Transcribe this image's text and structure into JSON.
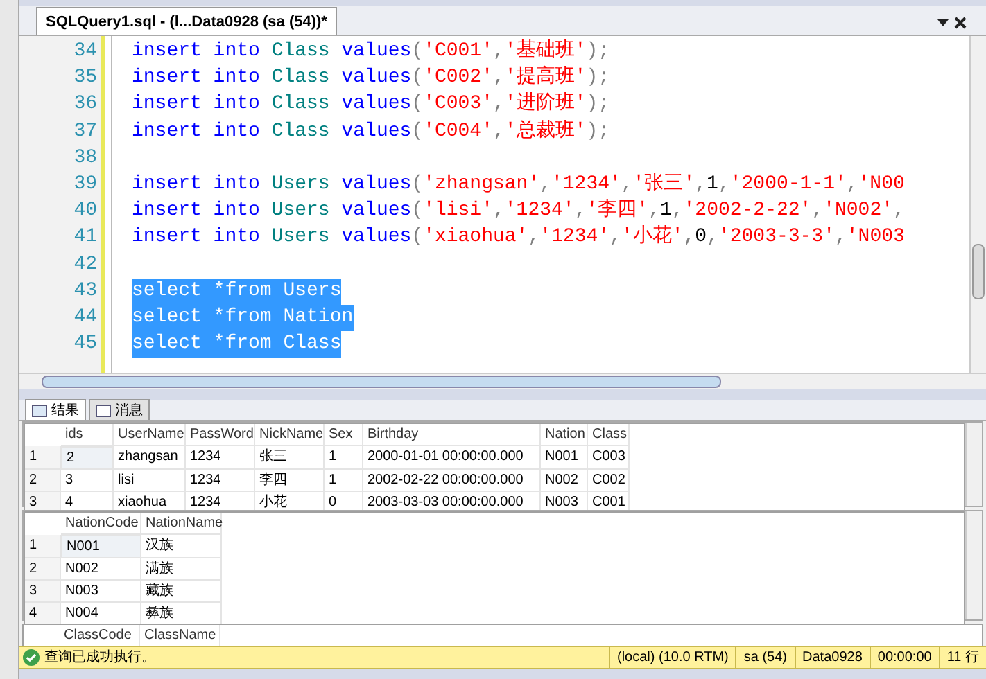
{
  "document_tab": {
    "title": "SQLQuery1.sql - (l...Data0928 (sa (54))*",
    "selected": true
  },
  "editor": {
    "lines": [
      {
        "number": "34",
        "selected": false,
        "tokens": [
          {
            "kind": "keyword",
            "text": "insert into "
          },
          {
            "kind": "object",
            "text": "Class "
          },
          {
            "kind": "keyword",
            "text": "values"
          },
          {
            "kind": "punct",
            "text": "("
          },
          {
            "kind": "string",
            "text": "'C001'"
          },
          {
            "kind": "punct",
            "text": ","
          },
          {
            "kind": "string",
            "text": "'基础班'"
          },
          {
            "kind": "punct",
            "text": ");"
          }
        ]
      },
      {
        "number": "35",
        "selected": false,
        "tokens": [
          {
            "kind": "keyword",
            "text": "insert into "
          },
          {
            "kind": "object",
            "text": "Class "
          },
          {
            "kind": "keyword",
            "text": "values"
          },
          {
            "kind": "punct",
            "text": "("
          },
          {
            "kind": "string",
            "text": "'C002'"
          },
          {
            "kind": "punct",
            "text": ","
          },
          {
            "kind": "string",
            "text": "'提高班'"
          },
          {
            "kind": "punct",
            "text": ");"
          }
        ]
      },
      {
        "number": "36",
        "selected": false,
        "tokens": [
          {
            "kind": "keyword",
            "text": "insert into "
          },
          {
            "kind": "object",
            "text": "Class "
          },
          {
            "kind": "keyword",
            "text": "values"
          },
          {
            "kind": "punct",
            "text": "("
          },
          {
            "kind": "string",
            "text": "'C003'"
          },
          {
            "kind": "punct",
            "text": ","
          },
          {
            "kind": "string",
            "text": "'进阶班'"
          },
          {
            "kind": "punct",
            "text": ");"
          }
        ]
      },
      {
        "number": "37",
        "selected": false,
        "tokens": [
          {
            "kind": "keyword",
            "text": "insert into "
          },
          {
            "kind": "object",
            "text": "Class "
          },
          {
            "kind": "keyword",
            "text": "values"
          },
          {
            "kind": "punct",
            "text": "("
          },
          {
            "kind": "string",
            "text": "'C004'"
          },
          {
            "kind": "punct",
            "text": ","
          },
          {
            "kind": "string",
            "text": "'总裁班'"
          },
          {
            "kind": "punct",
            "text": ");"
          }
        ]
      },
      {
        "number": "38",
        "selected": false
      },
      {
        "number": "39",
        "selected": false,
        "tokens": [
          {
            "kind": "keyword",
            "text": "insert into "
          },
          {
            "kind": "object",
            "text": "Users "
          },
          {
            "kind": "keyword",
            "text": "values"
          },
          {
            "kind": "punct",
            "text": "("
          },
          {
            "kind": "string",
            "text": "'zhangsan'"
          },
          {
            "kind": "punct",
            "text": ","
          },
          {
            "kind": "string",
            "text": "'1234'"
          },
          {
            "kind": "punct",
            "text": ","
          },
          {
            "kind": "string",
            "text": "'张三'"
          },
          {
            "kind": "punct",
            "text": ","
          },
          {
            "kind": "number",
            "text": "1"
          },
          {
            "kind": "punct",
            "text": ","
          },
          {
            "kind": "string",
            "text": "'2000-1-1'"
          },
          {
            "kind": "punct",
            "text": ","
          },
          {
            "kind": "string",
            "text": "'N00"
          }
        ]
      },
      {
        "number": "40",
        "selected": false,
        "tokens": [
          {
            "kind": "keyword",
            "text": "insert into "
          },
          {
            "kind": "object",
            "text": "Users "
          },
          {
            "kind": "keyword",
            "text": "values"
          },
          {
            "kind": "punct",
            "text": "("
          },
          {
            "kind": "string",
            "text": "'lisi'"
          },
          {
            "kind": "punct",
            "text": ","
          },
          {
            "kind": "string",
            "text": "'1234'"
          },
          {
            "kind": "punct",
            "text": ","
          },
          {
            "kind": "string",
            "text": "'李四'"
          },
          {
            "kind": "punct",
            "text": ","
          },
          {
            "kind": "number",
            "text": "1"
          },
          {
            "kind": "punct",
            "text": ","
          },
          {
            "kind": "string",
            "text": "'2002-2-22'"
          },
          {
            "kind": "punct",
            "text": ","
          },
          {
            "kind": "string",
            "text": "'N002'"
          },
          {
            "kind": "punct",
            "text": ","
          }
        ]
      },
      {
        "number": "41",
        "selected": false,
        "tokens": [
          {
            "kind": "keyword",
            "text": "insert into "
          },
          {
            "kind": "object",
            "text": "Users "
          },
          {
            "kind": "keyword",
            "text": "values"
          },
          {
            "kind": "punct",
            "text": "("
          },
          {
            "kind": "string",
            "text": "'xiaohua'"
          },
          {
            "kind": "punct",
            "text": ","
          },
          {
            "kind": "string",
            "text": "'1234'"
          },
          {
            "kind": "punct",
            "text": ","
          },
          {
            "kind": "string",
            "text": "'小花'"
          },
          {
            "kind": "punct",
            "text": ","
          },
          {
            "kind": "number",
            "text": "0"
          },
          {
            "kind": "punct",
            "text": ","
          },
          {
            "kind": "string",
            "text": "'2003-3-3'"
          },
          {
            "kind": "punct",
            "text": ","
          },
          {
            "kind": "string",
            "text": "'N003"
          }
        ]
      },
      {
        "number": "42",
        "selected": false
      },
      {
        "number": "43",
        "selected": true,
        "tokens": [
          {
            "kind": "plain",
            "text": "select *from Users"
          }
        ]
      },
      {
        "number": "44",
        "selected": true,
        "tokens": [
          {
            "kind": "plain",
            "text": "select *from Nation"
          }
        ]
      },
      {
        "number": "45",
        "selected": true,
        "tokens": [
          {
            "kind": "plain",
            "text": "select *from Class"
          }
        ]
      }
    ]
  },
  "result_tabs": [
    {
      "label": "结果",
      "selected": true
    },
    {
      "label": "消息",
      "selected": false
    }
  ],
  "grids": [
    {
      "columns": [
        "ids",
        "UserName",
        "PassWord",
        "NickName",
        "Sex",
        "Birthday",
        "Nation",
        "Class"
      ],
      "rows": [
        {
          "number": "1",
          "cells": [
            "2",
            "zhangsan",
            "1234",
            "张三",
            "1",
            "2000-01-01 00:00:00.000",
            "N001",
            "C003"
          ]
        },
        {
          "number": "2",
          "cells": [
            "3",
            "lisi",
            "1234",
            "李四",
            "1",
            "2002-02-22 00:00:00.000",
            "N002",
            "C002"
          ]
        },
        {
          "number": "3",
          "cells": [
            "4",
            "xiaohua",
            "1234",
            "小花",
            "0",
            "2003-03-03 00:00:00.000",
            "N003",
            "C001"
          ]
        }
      ]
    },
    {
      "columns": [
        "NationCode",
        "NationName"
      ],
      "rows": [
        {
          "number": "1",
          "cells": [
            "N001",
            "汉族"
          ]
        },
        {
          "number": "2",
          "cells": [
            "N002",
            "满族"
          ]
        },
        {
          "number": "3",
          "cells": [
            "N003",
            "藏族"
          ]
        },
        {
          "number": "4",
          "cells": [
            "N004",
            "彝族"
          ]
        }
      ]
    },
    {
      "columns": [
        "ClassCode",
        "ClassName"
      ]
    }
  ],
  "status_bar": {
    "message": "查询已成功执行。",
    "items": [
      "(local) (10.0 RTM)",
      "sa (54)",
      "Data0928",
      "00:00:00",
      "11 行"
    ]
  }
}
